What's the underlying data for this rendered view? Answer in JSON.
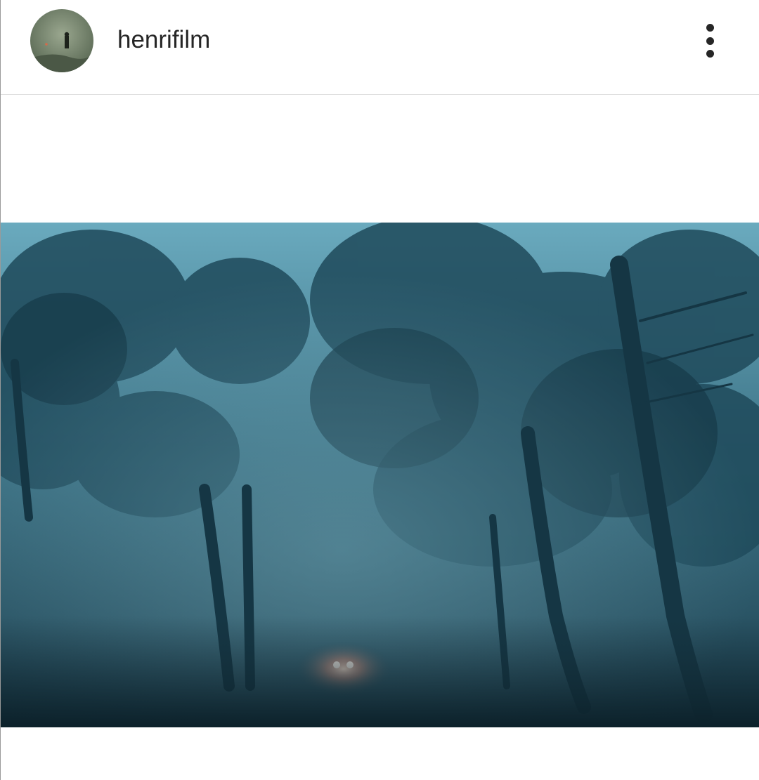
{
  "post": {
    "username": "henrifilm",
    "avatar_icon": "profile-photo",
    "more_icon": "vertical-dots-icon",
    "photo_subject": "foggy-forest-road-headlights-photo"
  },
  "colors": {
    "text": "#262626",
    "divider": "#dcdcdc",
    "fog": "#3d7286",
    "shadow": "#0f2731"
  }
}
